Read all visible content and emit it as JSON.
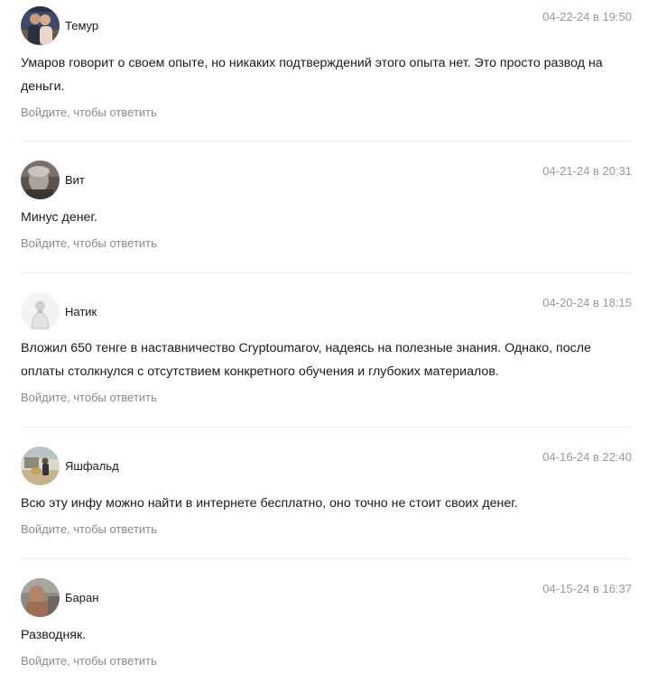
{
  "comments": [
    {
      "author": "Темур",
      "timestamp": "04-22-24 в 19:50",
      "text": "Умаров говорит о своем опыте, но никаких подтверждений этого опыта нет. Это просто развод на деньги.",
      "reply": "Войдите, чтобы ответить"
    },
    {
      "author": "Вит",
      "timestamp": "04-21-24 в 20:31",
      "text": "Минус денег.",
      "reply": "Войдите, чтобы ответить"
    },
    {
      "author": "Натик",
      "timestamp": "04-20-24 в 18:15",
      "text": "Вложил 650 тенге в наставничество Cryptoumarov, надеясь на полезные знания. Однако, после оплаты столкнулся с отсутствием конкретного обучения и глубоких материалов.",
      "reply": "Войдите, чтобы ответить"
    },
    {
      "author": "Яшфальд",
      "timestamp": "04-16-24 в 22:40",
      "text": "Всю эту инфу можно найти в интернете бесплатно, оно точно не стоит своих денег.",
      "reply": "Войдите, чтобы ответить"
    },
    {
      "author": "Баран",
      "timestamp": "04-15-24 в 16:37",
      "text": "Разводняк.",
      "reply": "Войдите, чтобы ответить"
    }
  ]
}
